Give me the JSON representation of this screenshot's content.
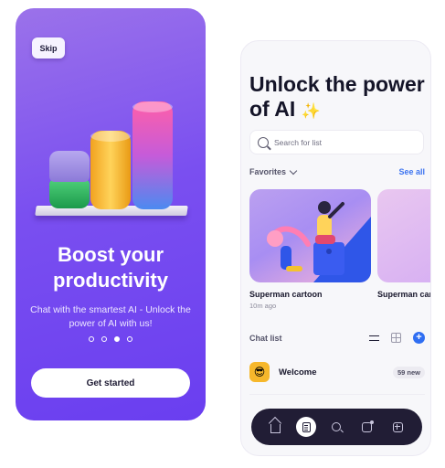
{
  "onboarding": {
    "skip_label": "Skip",
    "title": "Boost your productivity",
    "subtitle": "Chat with the smartest AI - Unlock the power of AI with us!",
    "pagination": {
      "total": 4,
      "active_index": 3
    },
    "cta_label": "Get started",
    "illustration": "3d-bar-chart-illustration"
  },
  "app": {
    "title": "Unlock the power of AI",
    "title_icon": "sparkles-icon",
    "search": {
      "placeholder": "Search for list",
      "value": "",
      "icon": "search-icon"
    },
    "favorites": {
      "label": "Favorites",
      "see_all_label": "See all",
      "cards": [
        {
          "title": "Superman cartoon",
          "time": "10m ago"
        },
        {
          "title": "Superman cartoon",
          "time": ""
        }
      ]
    },
    "chat_list": {
      "label": "Chat list",
      "items": [
        {
          "name": "Welcome",
          "badge": "59 new",
          "avatar": "😎"
        }
      ]
    },
    "bottom_nav": [
      {
        "icon": "home-icon",
        "active": false
      },
      {
        "icon": "document-icon",
        "active": true
      },
      {
        "icon": "search-icon",
        "active": false
      },
      {
        "icon": "note-icon",
        "active": false
      },
      {
        "icon": "add-square-icon",
        "active": false
      }
    ]
  },
  "colors": {
    "onboarding_gradient_start": "#9b72ea",
    "onboarding_gradient_end": "#6a3ef0",
    "accent_blue": "#3d74f0",
    "nav_background": "#211d35",
    "avatar_yellow": "#f6b72b"
  }
}
